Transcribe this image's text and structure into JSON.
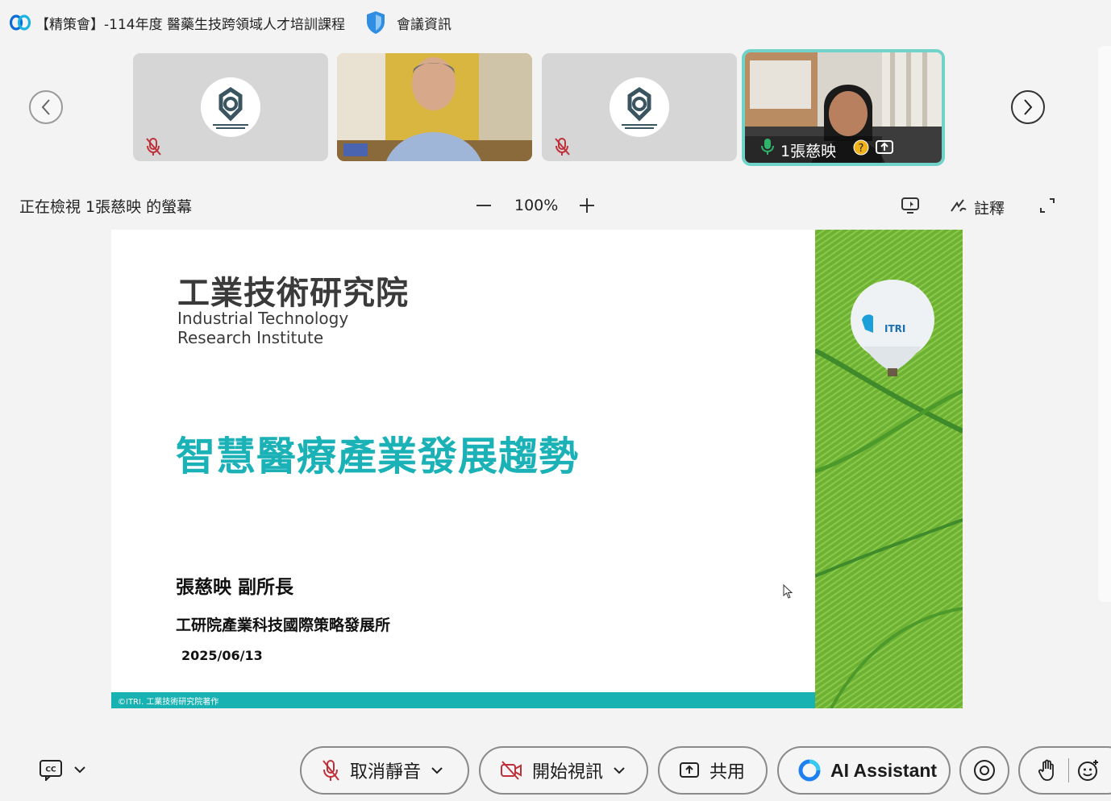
{
  "window": {
    "title": "【精策會】-114年度 醫藥生技跨領域人才培訓課程",
    "meeting_info": "會議資訊"
  },
  "participants": [
    {
      "name": "",
      "muted": true,
      "type": "logo"
    },
    {
      "name": "",
      "muted": false,
      "type": "video"
    },
    {
      "name": "",
      "muted": true,
      "type": "logo"
    },
    {
      "name": "1張慈映",
      "muted": false,
      "type": "video",
      "active": true
    }
  ],
  "viewing_bar": {
    "status": "正在檢視 1張慈映 的螢幕",
    "zoom": "100%",
    "annotate_label": "註釋"
  },
  "slide": {
    "org_cn": "工業技術研究院",
    "org_en_line1": "Industrial Technology",
    "org_en_line2": "Research Institute",
    "title": "智慧醫療產業發展趨勢",
    "speaker": "張慈映 副所長",
    "department": "工研院產業科技國際策略發展所",
    "date": "2025/06/13",
    "footer": "©ITRI. 工業技術研究院著作",
    "balloon_logo": "ITRI"
  },
  "toolbar": {
    "unmute_label": "取消靜音",
    "video_label": "開始視訊",
    "share_label": "共用",
    "ai_label": "AI Assistant"
  },
  "colors": {
    "accent_teal": "#1ab1b7",
    "active_border": "#6fd3c9",
    "mute_red": "#c0303a",
    "field_green": "#6db234"
  }
}
